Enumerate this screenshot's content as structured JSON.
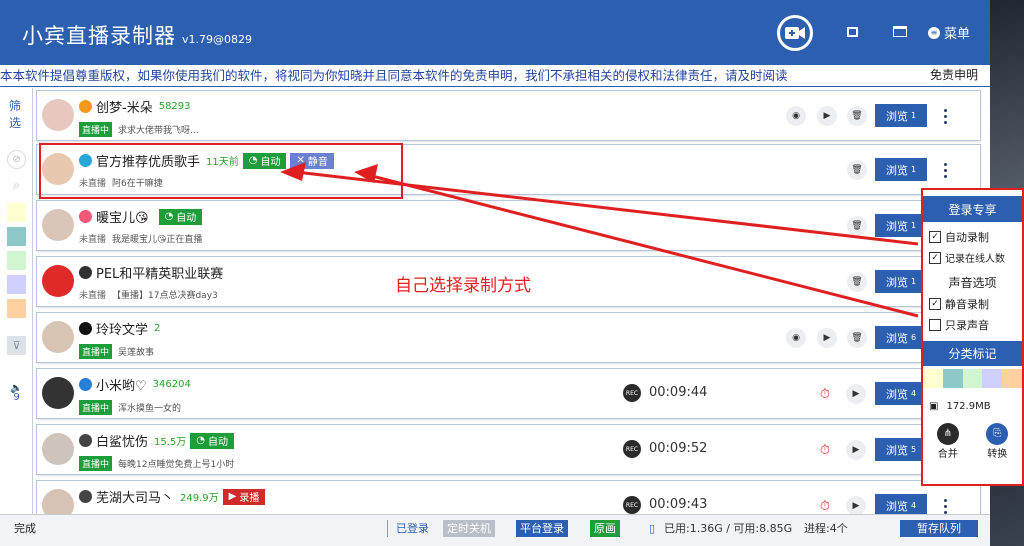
{
  "app": {
    "title": "小宾直播录制器",
    "version": "v1.79@0829",
    "menu_label": "菜单",
    "accent": "#2d5fb0"
  },
  "notice": {
    "text": "本本软件提倡尊重版权，如果你使用我们的软件，将视同为你知晓并且同意本软件的免责申明，我们不承担相关的侵权和法律责任，请及时阅读",
    "disclaimer": "免责申明"
  },
  "sidebar": {
    "filter_label": "筛选",
    "colors": [
      "#ffffd0",
      "#8fc8c8",
      "#d0f5d0",
      "#d0d0ff",
      "#ffd0a0"
    ]
  },
  "streams": [
    {
      "name": "创梦-米朵",
      "fans": "58293",
      "status": "直播中",
      "live": true,
      "desc": "求求大佬带我飞呀...",
      "browse": "浏览",
      "browse_count": "1",
      "avatar_color": "#e6c8c0",
      "platform_icon": "douyin-icon",
      "platform_color": "#f39a1a",
      "chips": []
    },
    {
      "name": "官方推荐优质歌手",
      "fans": "11天前",
      "status": "未直播",
      "live": false,
      "desc": "阿6在干嘛捷",
      "browse": "浏览",
      "browse_count": "1",
      "avatar_color": "#e8c9b0",
      "platform_icon": "bilibili-icon",
      "platform_color": "#27a7d8",
      "chips": [
        {
          "kind": "auto",
          "label": "自动"
        },
        {
          "kind": "mute",
          "label": "静音"
        }
      ]
    },
    {
      "name": "暖宝儿😘",
      "fans": "",
      "status": "未直播",
      "live": false,
      "desc": "我是暖宝儿😘正在直播",
      "browse": "浏览",
      "browse_count": "1",
      "avatar_color": "#d9c6b8",
      "platform_icon": "huya-icon",
      "platform_color": "#f05a78",
      "chips": [
        {
          "kind": "auto",
          "label": "自动"
        }
      ]
    },
    {
      "name": "PEL和平精英职业联赛",
      "fans": "",
      "status": "未直播",
      "live": false,
      "desc": "【重播】17点总决赛day3",
      "browse": "浏览",
      "browse_count": "1",
      "avatar_color": "#e02a2a",
      "platform_icon": "kuaishou-icon",
      "platform_color": "#333333",
      "chips": []
    },
    {
      "name": "玲玲文学",
      "fans": "2",
      "status": "直播中",
      "live": true,
      "desc": "吴莲故事",
      "browse": "浏览",
      "browse_count": "6",
      "avatar_color": "#d8c4b2",
      "platform_icon": "tiktok-icon",
      "platform_color": "#111111",
      "chips": []
    },
    {
      "name": "小米哟♡",
      "fans": "346204",
      "status": "直播中",
      "live": true,
      "desc": "浑水摸鱼一女的",
      "browse": "浏览",
      "browse_count": "4",
      "avatar_color": "#333333",
      "platform_icon": "kuaishou-icon",
      "platform_color": "#2680d8",
      "rec_time": "00:09:44",
      "chips": []
    },
    {
      "name": "白鲨忧伤",
      "fans": "15.5万",
      "status": "直播中",
      "live": true,
      "desc": "每晚12点睡觉免费上号1小时",
      "browse": "浏览",
      "browse_count": "5",
      "avatar_color": "#cfc4bc",
      "platform_icon": "kuaishou-icon",
      "platform_color": "#444444",
      "rec_time": "00:09:52",
      "chips": [
        {
          "kind": "auto",
          "label": "自动"
        }
      ]
    },
    {
      "name": "芜湖大司马丶",
      "fans": "249.9万",
      "status": "",
      "live": false,
      "desc": "",
      "browse": "浏览",
      "browse_count": "4",
      "avatar_color": "#d6c3b5",
      "platform_icon": "kuaishou-icon",
      "platform_color": "#444444",
      "rec_time": "00:09:43",
      "chips": [
        {
          "kind": "rec",
          "label": "录播"
        }
      ]
    }
  ],
  "popup": {
    "login_header": "登录专享",
    "auto_record": "自动录制",
    "record_online": "记录在线人数",
    "sound_header": "声音选项",
    "mute_record": "静音录制",
    "audio_only": "只录声音",
    "category_header": "分类标记",
    "size": "172.9MB",
    "merge": "合并",
    "convert": "转换",
    "auto_record_checked": true,
    "record_online_checked": true,
    "mute_record_checked": true,
    "audio_only_checked": false,
    "category_colors": [
      "#ffffd0",
      "#8fc8c8",
      "#d0f5d0",
      "#d0d0ff",
      "#ffd0a0"
    ]
  },
  "annotation": {
    "text": "自己选择录制方式",
    "color": "#e02020"
  },
  "statusbar": {
    "left": "完成",
    "logged": "已登录",
    "timer_off": "定时关机",
    "platform_login": "平台登录",
    "original": "原画",
    "disk": "已用:1.36G / 可用:8.85G",
    "process": "进程:4个",
    "pause_queue": "暂存队列"
  }
}
